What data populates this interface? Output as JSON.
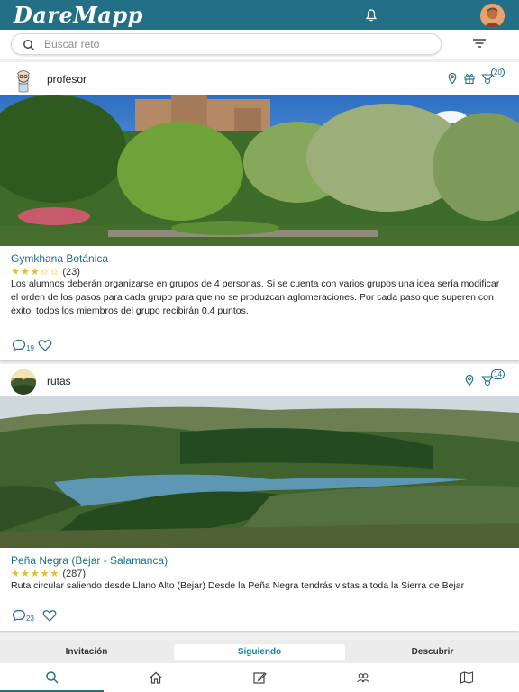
{
  "app": {
    "name": "DareMapp"
  },
  "search": {
    "placeholder": "Buscar reto",
    "value": ""
  },
  "feed": [
    {
      "user": "profesor",
      "badge_count": "20",
      "title": "Gymkhana Botánica",
      "stars": "★★★☆☆",
      "rating_count": "(23)",
      "description": "Los alumnos deberán organizarse en grupos de 4 personas. Si se cuenta con varios grupos una idea sería modificar el orden de los pasos para cada grupo para que no se produzcan aglomeraciones. Por cada paso que superen con éxito, todos los miembros del grupo recibirán 0,4 puntos.",
      "comments": "19"
    },
    {
      "user": "rutas",
      "badge_count": "14",
      "title": "Peña Negra (Bejar - Salamanca)",
      "stars": "★★★★★",
      "rating_count": "(287)",
      "description": "Ruta circular saliendo desde Llano Alto (Bejar) Desde la Peña Negra tendrás vistas a toda la Sierra de Bejar",
      "comments": "23"
    }
  ],
  "tabs": [
    {
      "label": "Invitación"
    },
    {
      "label": "Siguiendo",
      "active": true
    },
    {
      "label": "Descubrir"
    }
  ],
  "bottom_nav": [
    {
      "icon": "search-icon",
      "active": true
    },
    {
      "icon": "home-icon"
    },
    {
      "icon": "edit-icon"
    },
    {
      "icon": "people-icon"
    },
    {
      "icon": "map-icon"
    }
  ],
  "colors": {
    "primary": "#236f86",
    "accent": "#1c7fa3",
    "star": "#e3bd2a"
  }
}
